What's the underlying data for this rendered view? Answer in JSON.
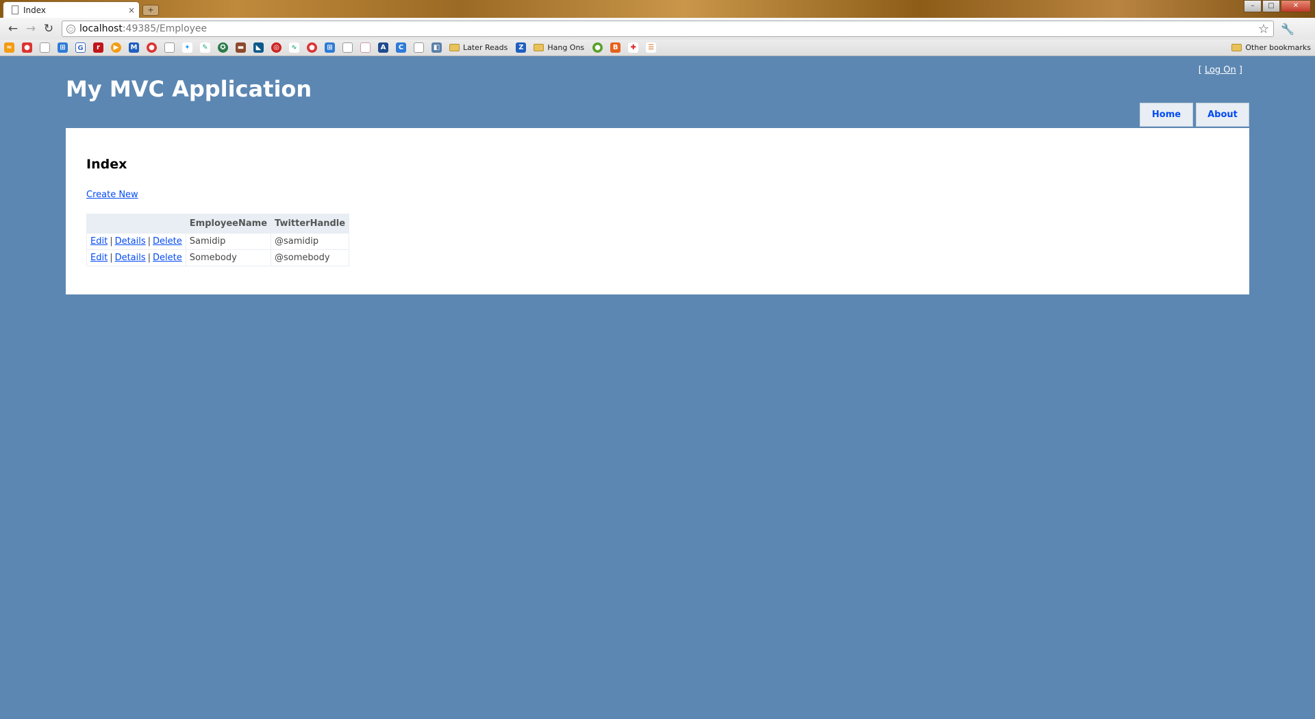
{
  "browser": {
    "tab_title": "Index",
    "tab_close": "×",
    "new_tab": "+",
    "url_host": "localhost",
    "url_path": ":49385/Employee",
    "win_min": "–",
    "win_max": "□",
    "win_close": "✕",
    "bookmarks": {
      "folder_later": "Later Reads",
      "folder_hang": "Hang Ons",
      "other": "Other bookmarks"
    }
  },
  "site": {
    "title": "My MVC Application",
    "logon_open": "[",
    "logon_label": "Log On",
    "logon_close": "]",
    "menu": {
      "home": "Home",
      "about": "About"
    }
  },
  "main": {
    "heading": "Index",
    "create_new": "Create New",
    "columns": [
      "",
      "EmployeeName",
      "TwitterHandle"
    ],
    "actions": {
      "edit": "Edit",
      "details": "Details",
      "delete": "Delete",
      "sep": "|"
    },
    "rows": [
      {
        "name": "Samidip",
        "handle": "@samidip"
      },
      {
        "name": "Somebody",
        "handle": "@somebody"
      }
    ]
  }
}
